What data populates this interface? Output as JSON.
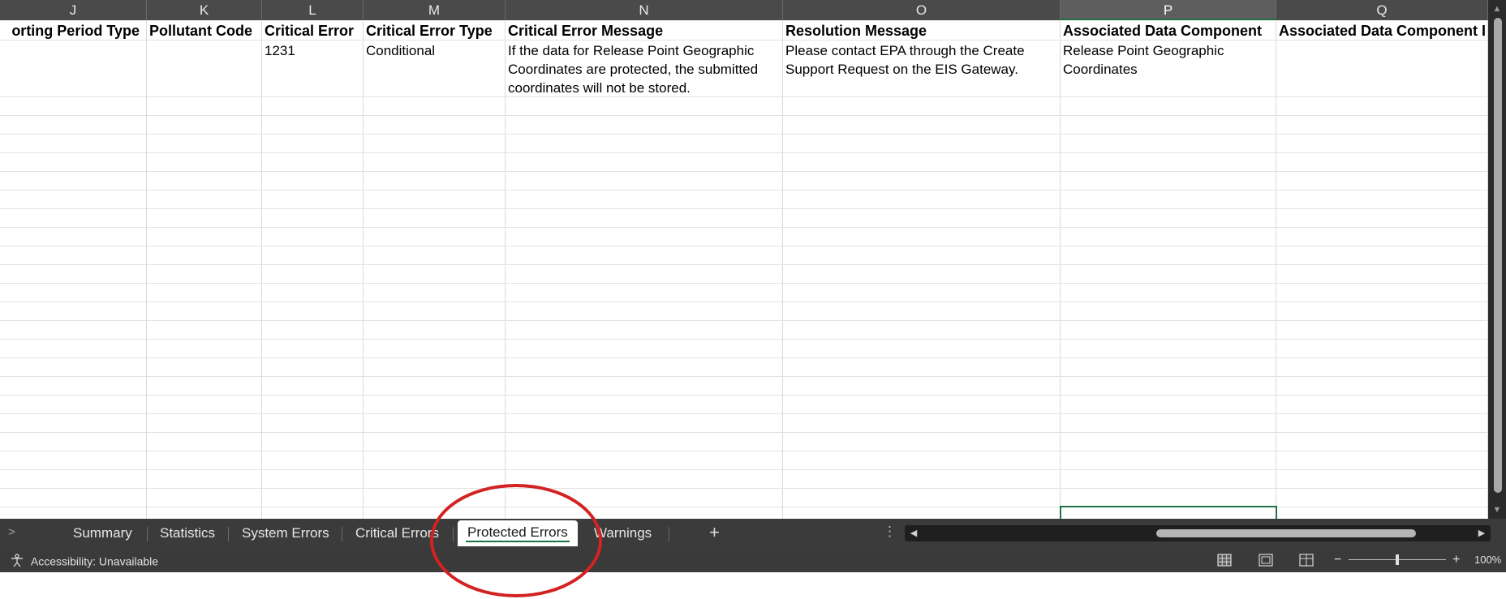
{
  "columns": [
    "J",
    "K",
    "L",
    "M",
    "N",
    "O",
    "P",
    "Q"
  ],
  "header_row": [
    "orting Period Type",
    "Pollutant Code",
    "Critical Error",
    "Critical Error Type",
    "Critical Error Message",
    "Resolution Message",
    "Associated Data Component",
    "Associated Data Component I"
  ],
  "data_row": [
    "",
    "",
    "1231",
    "Conditional",
    "If the data for Release Point Geographic Coordinates are protected, the submitted coordinates will not be stored.",
    "Please contact EPA through the Create Support Request on the EIS Gateway.",
    "Release Point Geographic Coordinates",
    ""
  ],
  "selected_column": "P",
  "sheet_tabs": [
    {
      "label": "Summary"
    },
    {
      "label": "Statistics"
    },
    {
      "label": "System Errors"
    },
    {
      "label": "Critical Errors"
    },
    {
      "label": "Protected Errors",
      "active": true
    },
    {
      "label": "Warnings"
    }
  ],
  "tab_bar": {
    "scroll_left": ">",
    "add_sheet": "+",
    "more_options": "⋮"
  },
  "status": {
    "accessibility": "Accessibility: Unavailable",
    "zoom_minus": "−",
    "zoom_plus": "+",
    "zoom": "100%"
  },
  "icons": {
    "accessibility": "accessibility-icon",
    "normal_view": "normal-view-icon",
    "page_layout": "page-layout-icon",
    "page_break": "page-break-preview-icon"
  },
  "colors": {
    "selection": "#1e7145",
    "annotation": "#d32222"
  }
}
